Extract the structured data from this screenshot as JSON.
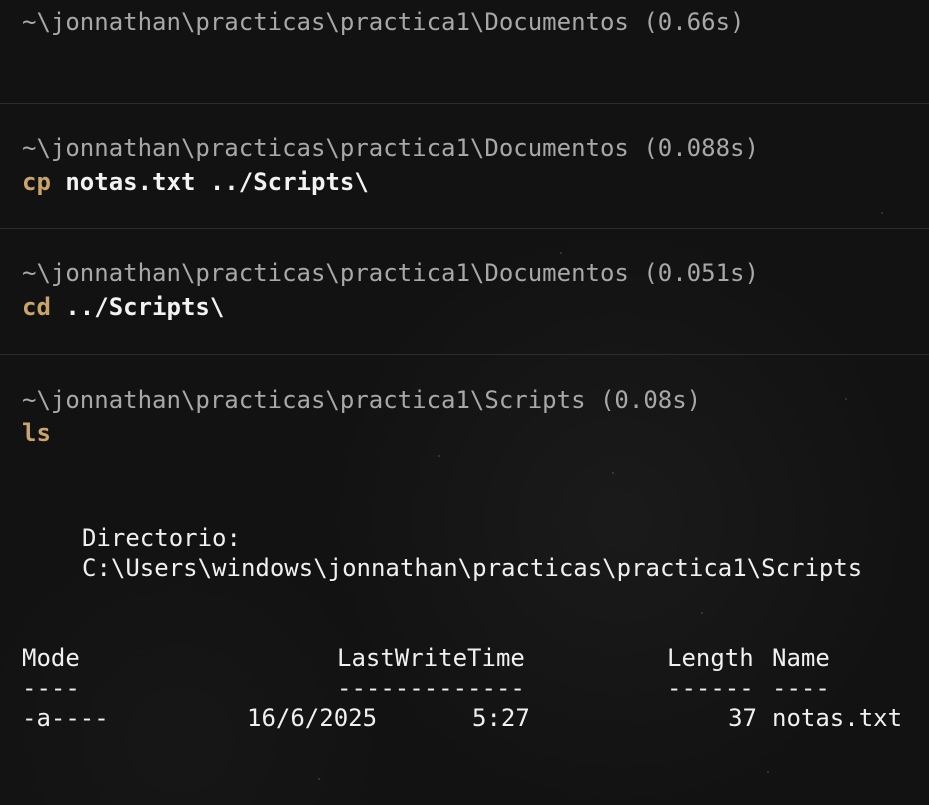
{
  "blocks": [
    {
      "prompt": "~\\jonnathan\\practicas\\practica1\\Documentos (0.66s)",
      "command": "",
      "args": ""
    },
    {
      "prompt": "~\\jonnathan\\practicas\\practica1\\Documentos (0.088s)",
      "command": "cp",
      "args": " notas.txt ../Scripts\\"
    },
    {
      "prompt": "~\\jonnathan\\practicas\\practica1\\Documentos (0.051s)",
      "command": "cd",
      "args": " ../Scripts\\"
    },
    {
      "prompt": "~\\jonnathan\\practicas\\practica1\\Scripts (0.08s)",
      "command": "ls",
      "args": ""
    }
  ],
  "listing": {
    "directory_label": "Directorio:",
    "directory_path": "C:\\Users\\windows\\jonnathan\\practicas\\practica1\\Scripts",
    "headers": {
      "mode": "Mode",
      "lastwritetime": "LastWriteTime",
      "length": "Length",
      "name": "Name"
    },
    "separators": {
      "mode": "----",
      "lastwritetime": "-------------",
      "length": "------",
      "name": "----"
    },
    "rows": [
      {
        "mode": "-a----",
        "date": "16/6/2025",
        "time": "5:27",
        "length": "37",
        "name": "notas.txt"
      }
    ]
  }
}
